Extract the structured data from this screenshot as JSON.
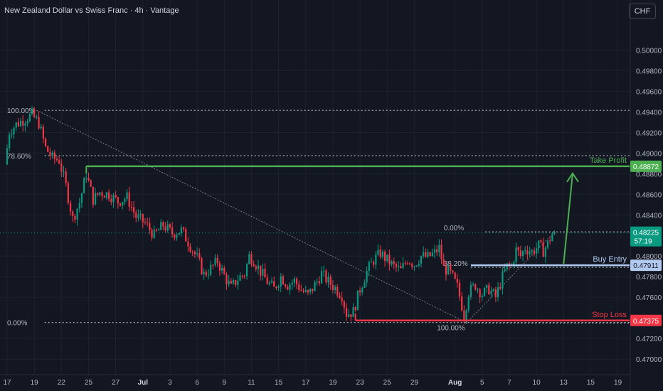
{
  "header": {
    "title": "New Zealand Dollar vs Swiss Franc · 4h · Vantage",
    "currency_button": "CHF"
  },
  "colors": {
    "background": "#131722",
    "up": "#089981",
    "down": "#f23645",
    "take_profit": "#4caf50",
    "stop_loss": "#f23645",
    "buy_entry": "#b2c9f0",
    "fib_line": "#e0e3eb",
    "axis_text": "#b2b5be"
  },
  "chart_data": {
    "type": "candlestick",
    "symbol": "NZDCHF",
    "timeframe": "4h",
    "y_axis": {
      "ticks": [
        "0.50000",
        "0.49800",
        "0.49600",
        "0.49400",
        "0.49200",
        "0.49000",
        "0.48800",
        "0.48600",
        "0.48400",
        "0.48000",
        "0.47800",
        "0.47600",
        "0.47200",
        "0.47000"
      ],
      "range": [
        0.4698,
        0.5021
      ]
    },
    "x_axis": {
      "ticks": [
        {
          "label": "17",
          "bar": 0
        },
        {
          "label": "19",
          "bar": 12
        },
        {
          "label": "22",
          "bar": 24
        },
        {
          "label": "25",
          "bar": 36
        },
        {
          "label": "27",
          "bar": 48
        },
        {
          "label": "Jul",
          "bar": 60
        },
        {
          "label": "3",
          "bar": 72
        },
        {
          "label": "6",
          "bar": 84
        },
        {
          "label": "9",
          "bar": 96
        },
        {
          "label": "11",
          "bar": 108
        },
        {
          "label": "15",
          "bar": 120
        },
        {
          "label": "17",
          "bar": 132
        },
        {
          "label": "19",
          "bar": 144
        },
        {
          "label": "23",
          "bar": 156
        },
        {
          "label": "25",
          "bar": 168
        },
        {
          "label": "29",
          "bar": 180
        },
        {
          "label": "Aug",
          "bar": 198
        },
        {
          "label": "5",
          "bar": 210
        },
        {
          "label": "7",
          "bar": 222
        },
        {
          "label": "10",
          "bar": 234
        },
        {
          "label": "13",
          "bar": 246
        },
        {
          "label": "15",
          "bar": 258
        },
        {
          "label": "19",
          "bar": 270
        }
      ]
    },
    "price_path": [
      [
        0,
        0.4889
      ],
      [
        2,
        0.4921
      ],
      [
        5,
        0.4928
      ],
      [
        8,
        0.4932
      ],
      [
        12,
        0.4937
      ],
      [
        15,
        0.4929
      ],
      [
        18,
        0.4905
      ],
      [
        21,
        0.4895
      ],
      [
        24,
        0.4893
      ],
      [
        27,
        0.4868
      ],
      [
        30,
        0.4836
      ],
      [
        33,
        0.4852
      ],
      [
        36,
        0.488
      ],
      [
        39,
        0.4855
      ],
      [
        42,
        0.4862
      ],
      [
        46,
        0.486
      ],
      [
        50,
        0.4853
      ],
      [
        54,
        0.4857
      ],
      [
        58,
        0.4838
      ],
      [
        62,
        0.4832
      ],
      [
        66,
        0.482
      ],
      [
        70,
        0.483
      ],
      [
        74,
        0.4822
      ],
      [
        78,
        0.4825
      ],
      [
        82,
        0.481
      ],
      [
        85,
        0.4798
      ],
      [
        88,
        0.4782
      ],
      [
        91,
        0.4788
      ],
      [
        94,
        0.4795
      ],
      [
        97,
        0.4781
      ],
      [
        100,
        0.4769
      ],
      [
        103,
        0.4778
      ],
      [
        106,
        0.4783
      ],
      [
        108,
        0.48
      ],
      [
        110,
        0.4796
      ],
      [
        113,
        0.4785
      ],
      [
        116,
        0.4775
      ],
      [
        119,
        0.4768
      ],
      [
        122,
        0.478
      ],
      [
        125,
        0.4772
      ],
      [
        128,
        0.4776
      ],
      [
        131,
        0.4767
      ],
      [
        134,
        0.4762
      ],
      [
        137,
        0.4772
      ],
      [
        140,
        0.4783
      ],
      [
        143,
        0.4775
      ],
      [
        146,
        0.4769
      ],
      [
        149,
        0.4762
      ],
      [
        151,
        0.4744
      ],
      [
        154,
        0.4746
      ],
      [
        157,
        0.4768
      ],
      [
        160,
        0.4785
      ],
      [
        163,
        0.4796
      ],
      [
        166,
        0.4803
      ],
      [
        169,
        0.4796
      ],
      [
        172,
        0.479
      ],
      [
        175,
        0.4786
      ],
      [
        178,
        0.4797
      ],
      [
        181,
        0.4792
      ],
      [
        184,
        0.48
      ],
      [
        187,
        0.4799
      ],
      [
        190,
        0.4803
      ],
      [
        192,
        0.4808
      ],
      [
        194,
        0.4788
      ],
      [
        196,
        0.4786
      ],
      [
        198,
        0.4779
      ],
      [
        200,
        0.477
      ],
      [
        202,
        0.4752
      ],
      [
        203,
        0.4742
      ],
      [
        205,
        0.4765
      ],
      [
        208,
        0.4772
      ],
      [
        211,
        0.4763
      ],
      [
        214,
        0.4768
      ],
      [
        217,
        0.476
      ],
      [
        220,
        0.478
      ],
      [
        222,
        0.479
      ],
      [
        224,
        0.4791
      ],
      [
        226,
        0.4806
      ],
      [
        228,
        0.48
      ],
      [
        230,
        0.4808
      ],
      [
        233,
        0.4804
      ],
      [
        236,
        0.481
      ],
      [
        238,
        0.4805
      ],
      [
        240,
        0.4812
      ],
      [
        242,
        0.4822
      ]
    ],
    "annotations": {
      "take_profit": {
        "label": "Take Profit",
        "price": "0.48872",
        "value": 0.48872
      },
      "buy_entry": {
        "label": "Buy Entry",
        "price": "0.47911",
        "value": 0.47911
      },
      "stop_loss": {
        "label": "Stop Loss",
        "price": "0.47375",
        "value": 0.47375
      },
      "current_price": {
        "price": "0.48225",
        "value": 0.48225,
        "countdown": "57:19"
      },
      "fib_left": {
        "levels": [
          {
            "label": "100.00%",
            "value": 0.49415
          },
          {
            "label": "78.60%",
            "value": 0.48975
          },
          {
            "label": "0.00%",
            "value": 0.47355
          }
        ]
      },
      "fib_right": {
        "levels": [
          {
            "label": "0.00%",
            "value": 0.48235
          },
          {
            "label": "38.20%",
            "value": 0.4789
          },
          {
            "label": "100.00%",
            "value": 0.4735
          }
        ]
      }
    }
  }
}
